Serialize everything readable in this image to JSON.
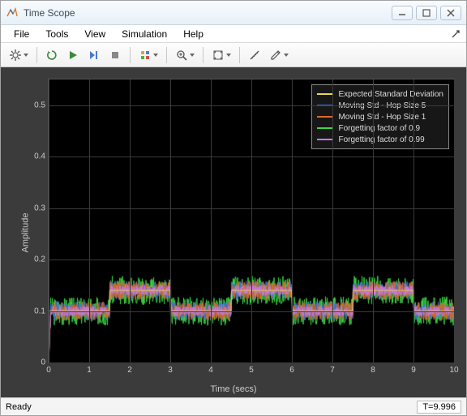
{
  "window": {
    "title": "Time Scope"
  },
  "menu": {
    "items": [
      "File",
      "Tools",
      "View",
      "Simulation",
      "Help"
    ]
  },
  "toolbar": {
    "buttons": [
      {
        "name": "config",
        "icon": "gear",
        "dd": true
      },
      {
        "sep": true
      },
      {
        "name": "restart",
        "icon": "restart"
      },
      {
        "name": "run",
        "icon": "play"
      },
      {
        "name": "step",
        "icon": "step"
      },
      {
        "name": "stop",
        "icon": "stop"
      },
      {
        "sep": true
      },
      {
        "name": "highlight",
        "icon": "highlight",
        "dd": true
      },
      {
        "sep": true
      },
      {
        "name": "zoom",
        "icon": "zoom",
        "dd": true
      },
      {
        "sep": true
      },
      {
        "name": "autoscale",
        "icon": "autoscale",
        "dd": true
      },
      {
        "sep": true
      },
      {
        "name": "measure",
        "icon": "measure"
      },
      {
        "name": "annotate",
        "icon": "pencil",
        "dd": true
      }
    ]
  },
  "status": {
    "ready": "Ready",
    "time": "T=9.996"
  },
  "chart_data": {
    "type": "line",
    "title": "",
    "xlabel": "Time (secs)",
    "ylabel": "Amplitude",
    "xlim": [
      0,
      10
    ],
    "ylim": [
      0,
      0.55
    ],
    "xticks": [
      0,
      1,
      2,
      3,
      4,
      5,
      6,
      7,
      8,
      9,
      10
    ],
    "yticks": [
      0,
      0.1,
      0.2,
      0.3,
      0.4,
      0.5
    ],
    "legend_position": "top-right",
    "series": [
      {
        "name": "Expected Standard Deviation",
        "color": "#e8d84a",
        "segments": [
          {
            "x": [
              0,
              1.5
            ],
            "y": 0.1
          },
          {
            "x": [
              1.5,
              3
            ],
            "y": 0.14
          },
          {
            "x": [
              3,
              4.5
            ],
            "y": 0.1
          },
          {
            "x": [
              4.5,
              6
            ],
            "y": 0.14
          },
          {
            "x": [
              6,
              7.5
            ],
            "y": 0.1
          },
          {
            "x": [
              7.5,
              9
            ],
            "y": 0.14
          },
          {
            "x": [
              9,
              10
            ],
            "y": 0.1
          }
        ]
      },
      {
        "name": "Moving Std - Hop Size 5",
        "color": "#3a6fd8",
        "baseline_segments": "same_as_expected",
        "noise_std": 0.018
      },
      {
        "name": "Moving Std - Hop Size 1",
        "color": "#d86a2a",
        "baseline_segments": "same_as_expected",
        "noise_std": 0.018
      },
      {
        "name": "Forgetting factor of 0.9",
        "color": "#39d845",
        "baseline_segments": "same_as_expected",
        "noise_std": 0.028
      },
      {
        "name": "Forgetting factor of 0.99",
        "color": "#c77ae0",
        "baseline_segments": "same_as_expected",
        "noise_std": 0.01
      }
    ]
  }
}
